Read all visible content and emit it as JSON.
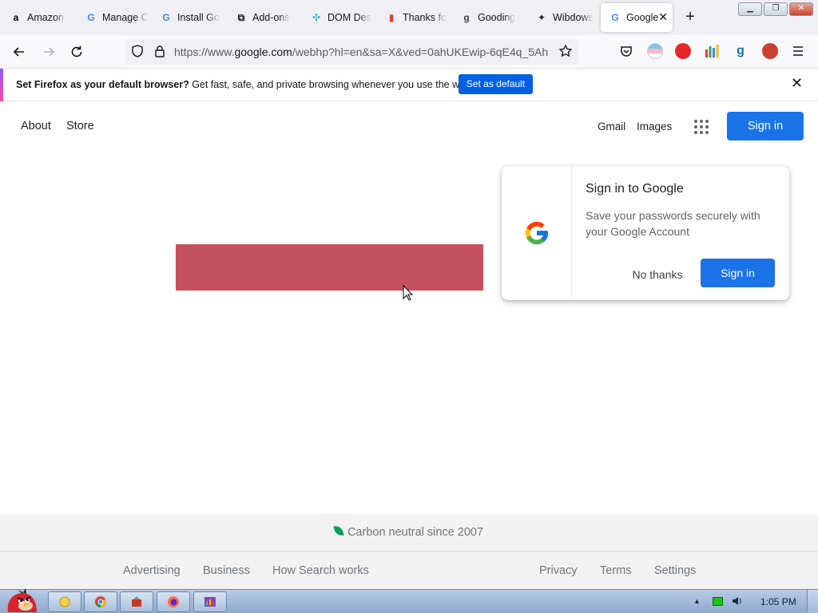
{
  "browser": {
    "tabs": [
      {
        "label": "Amazon.",
        "icon": "amazon-icon",
        "glyph": "a"
      },
      {
        "label": "Manage C",
        "icon": "google-g-icon",
        "glyph": "G"
      },
      {
        "label": "Install Go",
        "icon": "google-g-icon",
        "glyph": "G"
      },
      {
        "label": "Add-ons",
        "icon": "puzzle-icon",
        "glyph": "⧉"
      },
      {
        "label": "DOM Des",
        "icon": "dom-design-icon",
        "glyph": "✣"
      },
      {
        "label": "Thanks fo",
        "icon": "bar-chart-icon",
        "glyph": "▮"
      },
      {
        "label": "Gooding",
        "icon": "grammarly-g-icon",
        "glyph": "g"
      },
      {
        "label": "Wibdows",
        "icon": "wibdows-icon",
        "glyph": "✦"
      },
      {
        "label": "Google",
        "icon": "google-g-icon",
        "glyph": "G",
        "active": true,
        "close": "✕"
      }
    ],
    "new_tab_glyph": "+",
    "window_buttons": [
      "▁",
      "❐",
      "✕"
    ],
    "url": {
      "prefix": "https://www.",
      "host": "google.com",
      "path": "/webhp?hl=en&sa=X&ved=0ahUKEwip-6qE4q_5Ah"
    }
  },
  "notification": {
    "bold": "Set Firefox as your default browser?",
    "text": " Get fast, safe, and private browsing whenever you use the web.",
    "button": "Set as default",
    "close": "✕"
  },
  "google": {
    "left_links": [
      "About",
      "Store"
    ],
    "right_links": [
      "Gmail",
      "Images"
    ],
    "signin_label": "Sign in",
    "popup": {
      "title": "Sign in to Google",
      "body": "Save your passwords securely with your Google Account",
      "no_thanks": "No thanks",
      "sign_in": "Sign in"
    },
    "footer": {
      "carbon": "Carbon neutral since 2007",
      "left_links": [
        "Advertising",
        "Business",
        "How Search works"
      ],
      "right_links": [
        "Privacy",
        "Terms",
        "Settings"
      ]
    }
  },
  "taskbar": {
    "clock": "1:05 PM"
  },
  "colors": {
    "google_blue": "#1a73e8",
    "firefox_blue": "#0061e0",
    "red_block": "#c4515f"
  }
}
